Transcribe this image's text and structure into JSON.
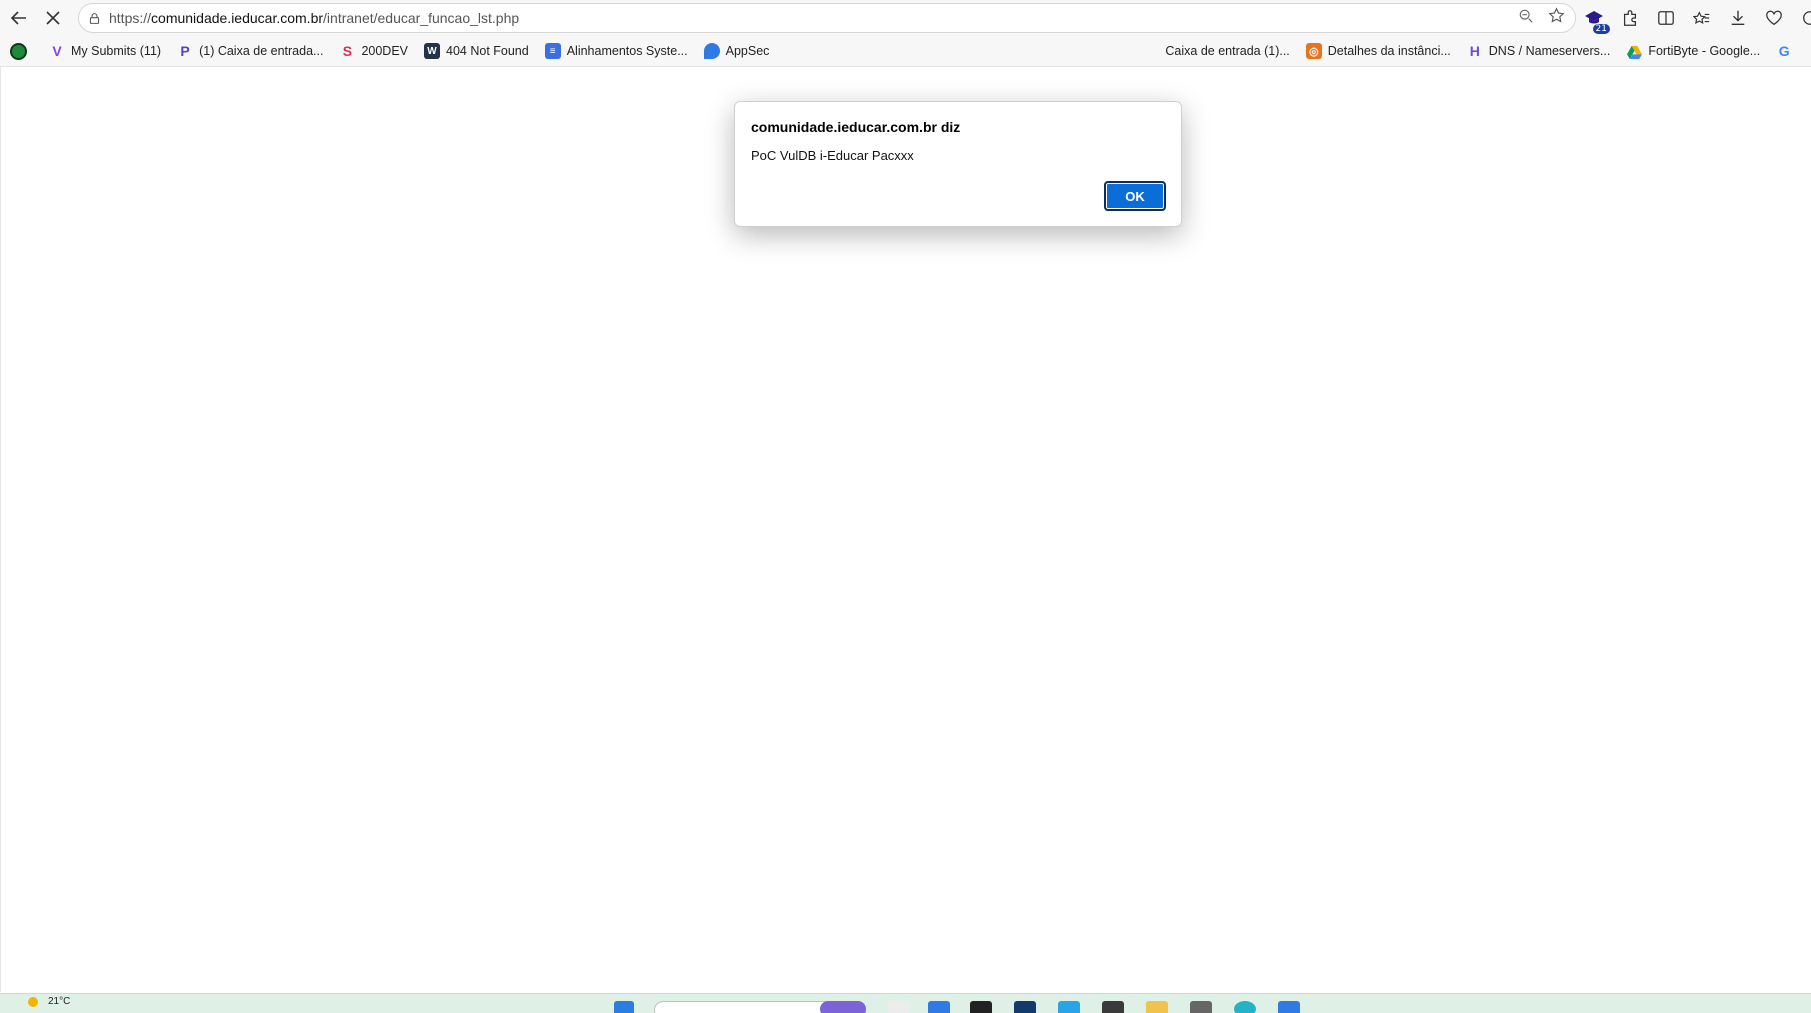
{
  "toolbar": {
    "url_scheme": "https://",
    "url_host": "comunidade.ieducar.com.br",
    "url_path": "/intranet/educar_funcao_lst.php",
    "extension_badge": "21"
  },
  "bookmarks": [
    {
      "label": "",
      "icon": "green-dot-icon",
      "color": "#1f8a3a"
    },
    {
      "label": "My Submits (11)",
      "icon": "v-logo-icon",
      "color": "#8a3ff0"
    },
    {
      "label": "(1) Caixa de entrada...",
      "icon": "p-logo-icon",
      "color": "#5b3fc4"
    },
    {
      "label": "200DEV",
      "icon": "200dev-logo-icon",
      "color": "#d9304f"
    },
    {
      "label": "404 Not Found",
      "icon": "w-logo-icon",
      "color": "#24324a"
    },
    {
      "label": "Alinhamentos Syste...",
      "icon": "doc-icon",
      "color": "#3b6fe0"
    },
    {
      "label": "AppSec",
      "icon": "drop-icon",
      "color": "#2f7ae5"
    },
    {
      "label": "Caixa de entrada (1)...",
      "icon": "",
      "color": ""
    },
    {
      "label": "Detalhes da instânci...",
      "icon": "orange-square-icon",
      "color": "#e8741e"
    },
    {
      "label": "DNS / Nameservers...",
      "icon": "h-logo-icon",
      "color": "#6c4bd8"
    },
    {
      "label": "FortiByte - Google...",
      "icon": "drive-icon",
      "color": "#f2b400"
    },
    {
      "label": "G",
      "icon": "google-icon",
      "color": "#4285f4"
    }
  ],
  "dialog": {
    "title": "comunidade.ieducar.com.br diz",
    "message": "PoC VulDB i-Educar Pacxxx",
    "ok_label": "OK"
  },
  "taskbar": {
    "weather": "21°C"
  }
}
